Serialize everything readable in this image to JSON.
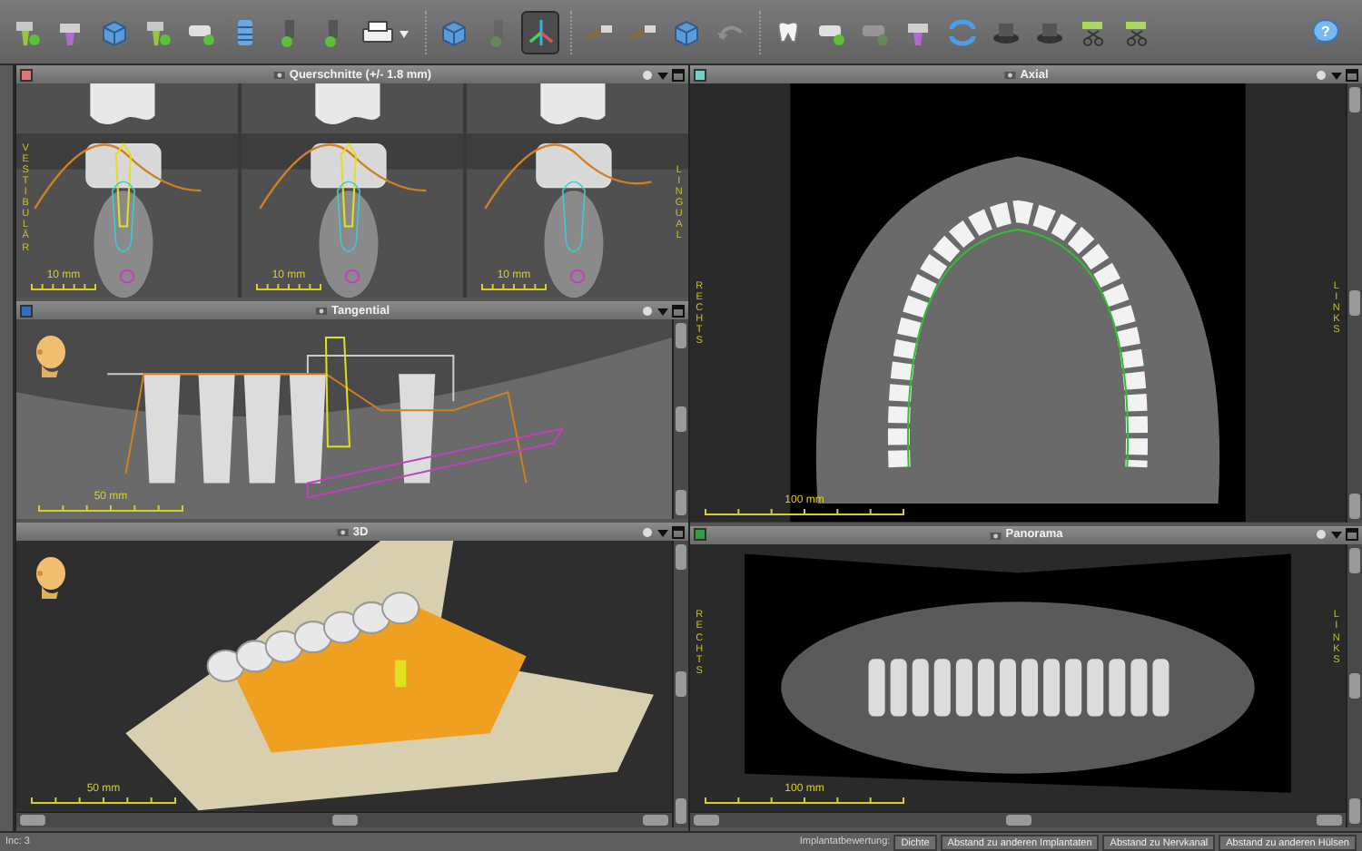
{
  "toolbar": {
    "groups": [
      {
        "buttons": [
          {
            "kind": "implant",
            "selected": false,
            "disabled": false
          },
          {
            "kind": "implant_alt",
            "selected": false,
            "disabled": false
          },
          {
            "kind": "cube",
            "selected": false,
            "disabled": false
          },
          {
            "kind": "implant",
            "selected": false,
            "disabled": false
          },
          {
            "kind": "sleeve",
            "selected": false,
            "disabled": false
          },
          {
            "kind": "stack",
            "selected": false,
            "disabled": false
          },
          {
            "kind": "post",
            "selected": false,
            "disabled": false
          },
          {
            "kind": "post",
            "selected": false,
            "disabled": false
          },
          {
            "kind": "printer",
            "selected": false,
            "disabled": false
          }
        ]
      },
      {
        "buttons": [
          {
            "kind": "cube",
            "selected": false,
            "disabled": false
          },
          {
            "kind": "post",
            "selected": false,
            "disabled": true
          },
          {
            "kind": "axes",
            "selected": true,
            "disabled": false
          }
        ]
      },
      {
        "buttons": [
          {
            "kind": "tool",
            "selected": false,
            "disabled": false
          },
          {
            "kind": "tool",
            "selected": false,
            "disabled": false
          },
          {
            "kind": "cube",
            "selected": false,
            "disabled": false
          },
          {
            "kind": "undo",
            "selected": false,
            "disabled": true
          }
        ]
      },
      {
        "buttons": [
          {
            "kind": "tooth",
            "selected": false,
            "disabled": false
          },
          {
            "kind": "sleeve",
            "selected": false,
            "disabled": false
          },
          {
            "kind": "sleeve",
            "selected": false,
            "disabled": true
          },
          {
            "kind": "implant_alt",
            "selected": false,
            "disabled": false
          },
          {
            "kind": "arrows",
            "selected": false,
            "disabled": false
          },
          {
            "kind": "device",
            "selected": false,
            "disabled": false
          },
          {
            "kind": "device",
            "selected": false,
            "disabled": false
          },
          {
            "kind": "scissors",
            "selected": false,
            "disabled": false
          },
          {
            "kind": "scissors",
            "selected": false,
            "disabled": false
          }
        ]
      },
      {
        "buttons": [
          {
            "kind": "help",
            "label": "?",
            "selected": false,
            "disabled": false
          }
        ]
      }
    ]
  },
  "views": {
    "left": [
      {
        "title": "Querschnitte (+/- 1.8 mm)",
        "kind": "cross_sections",
        "color": "#e07474",
        "side_labels": {
          "left": "VESTIBULÄR",
          "right": "LINGUAL"
        },
        "slices": [
          {
            "scale": "10 mm"
          },
          {
            "scale": "10 mm"
          },
          {
            "scale": "10 mm"
          }
        ]
      },
      {
        "title": "Tangential",
        "kind": "tangential",
        "color": "#2f6fc4",
        "scale": "50 mm"
      },
      {
        "title": "3D",
        "kind": "model",
        "scale": "50 mm"
      }
    ],
    "right": [
      {
        "title": "Axial",
        "kind": "axial",
        "color": "#6fd0cc",
        "scale": "100 mm",
        "side_labels": {
          "left": "RECHTS",
          "right": "LINKS"
        }
      },
      {
        "title": "Panorama",
        "kind": "panorama",
        "color": "#2f9e3c",
        "scale": "100 mm",
        "side_labels": {
          "left": "RECHTS",
          "right": "LINKS"
        }
      }
    ]
  },
  "status_bar": {
    "info": "Inc: 3",
    "label": "Implantatbewertung:",
    "buttons": [
      {
        "label": "Dichte"
      },
      {
        "label": "Abstand zu anderen Implantaten"
      },
      {
        "label": "Abstand zu Nervkanal"
      },
      {
        "label": "Abstand zu anderen Hülsen"
      }
    ]
  }
}
